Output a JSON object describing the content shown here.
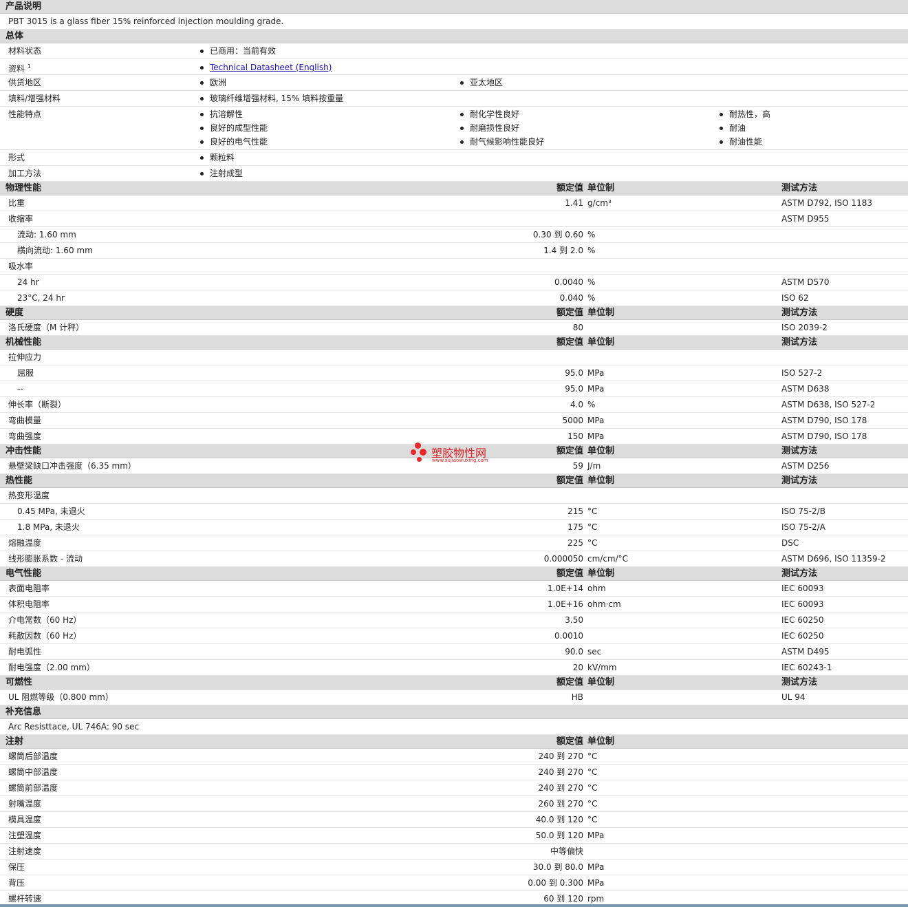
{
  "headers": {
    "value": "额定值",
    "unit": "单位制",
    "method": "测试方法"
  },
  "description": {
    "title": "产品说明",
    "text": "PBT 3015 is a glass fiber 15% reinforced injection moulding grade."
  },
  "general": {
    "title": "总体",
    "status_label": "材料状态",
    "status_value": "已商用：当前有效",
    "datasheet_label": "资料",
    "datasheet_sup": "1",
    "datasheet_link": "Technical Datasheet (English)",
    "region_label": "供货地区",
    "regions": [
      "欧洲",
      "亚太地区"
    ],
    "filler_label": "填料/增强材料",
    "filler_value": "玻璃纤维增强材料, 15% 填料按重量",
    "features_label": "性能特点",
    "features": [
      "抗溶解性",
      "耐化学性良好",
      "耐热性，高",
      "良好的成型性能",
      "耐磨损性良好",
      "耐油",
      "良好的电气性能",
      "耐气候影响性能良好",
      "耐油性能"
    ],
    "form_label": "形式",
    "form_value": "颗粒料",
    "process_label": "加工方法",
    "process_value": "注射成型"
  },
  "sections": [
    {
      "title": "物理性能",
      "cols": true,
      "rows": [
        {
          "label": "比重",
          "value": "1.41",
          "unit": "g/cm³",
          "method": "ASTM D792, ISO 1183"
        },
        {
          "label": "收缩率",
          "value": "",
          "unit": "",
          "method": "ASTM D955"
        },
        {
          "label": "流动: 1.60 mm",
          "sub": true,
          "value": "0.30 到  0.60",
          "unit": "%",
          "method": ""
        },
        {
          "label": "横向流动: 1.60 mm",
          "sub": true,
          "value": "1.4 到  2.0",
          "unit": "%",
          "method": ""
        },
        {
          "label": "吸水率",
          "value": "",
          "unit": "",
          "method": ""
        },
        {
          "label": "24 hr",
          "sub": true,
          "value": "0.0040",
          "unit": "%",
          "method": "ASTM D570"
        },
        {
          "label": "23°C, 24 hr",
          "sub": true,
          "value": "0.040",
          "unit": "%",
          "method": "ISO 62"
        }
      ]
    },
    {
      "title": "硬度",
      "cols": true,
      "rows": [
        {
          "label": "洛氏硬度（M 计秤）",
          "value": "80",
          "unit": "",
          "method": "ISO 2039-2"
        }
      ]
    },
    {
      "title": "机械性能",
      "cols": true,
      "rows": [
        {
          "label": "拉伸应力",
          "value": "",
          "unit": "",
          "method": ""
        },
        {
          "label": "屈服",
          "sub": true,
          "value": "95.0",
          "unit": "MPa",
          "method": "ISO 527-2"
        },
        {
          "label": "--",
          "sub": true,
          "value": "95.0",
          "unit": "MPa",
          "method": "ASTM D638"
        },
        {
          "label": "伸长率（断裂）",
          "value": "4.0",
          "unit": "%",
          "method": "ASTM D638, ISO 527-2"
        },
        {
          "label": "弯曲模量",
          "value": "5000",
          "unit": "MPa",
          "method": "ASTM D790, ISO 178"
        },
        {
          "label": "弯曲强度",
          "value": "150",
          "unit": "MPa",
          "method": "ASTM D790, ISO 178"
        }
      ]
    },
    {
      "title": "冲击性能",
      "cols": true,
      "rows": [
        {
          "label": "悬壁梁缺口冲击强度（6.35 mm）",
          "value": "59",
          "unit": "J/m",
          "method": "ASTM D256"
        }
      ]
    },
    {
      "title": "热性能",
      "cols": true,
      "rows": [
        {
          "label": "热变形温度",
          "value": "",
          "unit": "",
          "method": ""
        },
        {
          "label": "0.45 MPa, 未退火",
          "sub": true,
          "value": "215",
          "unit": "°C",
          "method": "ISO 75-2/B"
        },
        {
          "label": "1.8 MPa, 未退火",
          "sub": true,
          "value": "175",
          "unit": "°C",
          "method": "ISO 75-2/A"
        },
        {
          "label": "熔融温度",
          "value": "225",
          "unit": "°C",
          "method": "DSC"
        },
        {
          "label": "线形膨胀系数 - 流动",
          "value": "0.000050",
          "unit": "cm/cm/°C",
          "method": "ASTM D696, ISO 11359-2"
        }
      ]
    },
    {
      "title": "电气性能",
      "cols": true,
      "rows": [
        {
          "label": "表面电阻率",
          "value": "1.0E+14",
          "unit": "ohm",
          "method": "IEC 60093"
        },
        {
          "label": "体积电阻率",
          "value": "1.0E+16",
          "unit": "ohm·cm",
          "method": "IEC 60093"
        },
        {
          "label": "介电常数（60 Hz）",
          "value": "3.50",
          "unit": "",
          "method": "IEC 60250"
        },
        {
          "label": "耗散因数（60 Hz）",
          "value": "0.0010",
          "unit": "",
          "method": "IEC 60250"
        },
        {
          "label": "耐电弧性",
          "value": "90.0",
          "unit": "sec",
          "method": "ASTM D495"
        },
        {
          "label": "耐电强度（2.00 mm）",
          "value": "20",
          "unit": "kV/mm",
          "method": "IEC 60243-1"
        }
      ]
    },
    {
      "title": "可燃性",
      "cols": true,
      "rows": [
        {
          "label": "UL 阻燃等级（0.800 mm）",
          "value": "HB",
          "unit": "",
          "method": "UL 94"
        }
      ]
    },
    {
      "title": "补充信息",
      "cols": false,
      "free": "Arc Resisttace, UL 746A: 90 sec",
      "rows": []
    },
    {
      "title": "注射",
      "cols": true,
      "nomethod": true,
      "rows": [
        {
          "label": "螺筒后部温度",
          "value": "240 到  270",
          "unit": "°C",
          "method": ""
        },
        {
          "label": "螺筒中部温度",
          "value": "240 到  270",
          "unit": "°C",
          "method": ""
        },
        {
          "label": "螺筒前部温度",
          "value": "240 到  270",
          "unit": "°C",
          "method": ""
        },
        {
          "label": "射嘴温度",
          "value": "260 到  270",
          "unit": "°C",
          "method": ""
        },
        {
          "label": "模具温度",
          "value": "40.0 到  120",
          "unit": "°C",
          "method": ""
        },
        {
          "label": "注塑温度",
          "value": "50.0 到  120",
          "unit": "MPa",
          "method": ""
        },
        {
          "label": "注射速度",
          "value": "中等偏快",
          "unit": "",
          "method": ""
        },
        {
          "label": "保压",
          "value": "30.0 到  80.0",
          "unit": "MPa",
          "method": ""
        },
        {
          "label": "背压",
          "value": "0.00 到  0.300",
          "unit": "MPa",
          "method": ""
        },
        {
          "label": "螺杆转速",
          "value": "60 到  120",
          "unit": "rpm",
          "method": ""
        }
      ]
    }
  ],
  "watermark": {
    "title": "塑胶物性网",
    "url": "www.sujiaowuxing.com"
  }
}
